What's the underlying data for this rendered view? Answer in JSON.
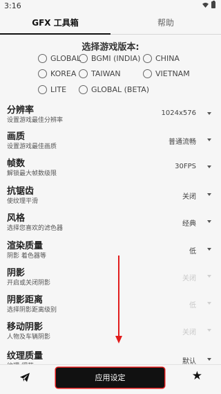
{
  "status": {
    "time": "3:16"
  },
  "tabs": [
    {
      "label": "GFX 工具箱",
      "active": true
    },
    {
      "label": "帮助",
      "active": false
    }
  ],
  "version": {
    "title": "选择游戏版本:",
    "options": [
      "GLOBAL",
      "BGMI (INDIA)",
      "CHINA",
      "KOREA",
      "TAIWAN",
      "VIETNAM",
      "LITE",
      "GLOBAL (BETA)"
    ]
  },
  "settings": [
    {
      "title": "分辨率",
      "desc": "设置游戏最佳分辨率",
      "value": "1024x576",
      "enabled": true
    },
    {
      "title": "画质",
      "desc": "设置游戏最佳画质",
      "value": "普通流畅",
      "enabled": true
    },
    {
      "title": "帧数",
      "desc": "解锁最大帧数级限",
      "value": "30FPS",
      "enabled": true
    },
    {
      "title": "抗锯齿",
      "desc": "使纹理平滑",
      "value": "关闭",
      "enabled": true
    },
    {
      "title": "风格",
      "desc": "选择您喜欢的滤色器",
      "value": "经典",
      "enabled": true
    },
    {
      "title": "渲染质量",
      "desc": "阴影 着色器等",
      "value": "低",
      "enabled": true
    },
    {
      "title": "阴影",
      "desc": "开启或关闭阴影",
      "value": "关闭",
      "enabled": false
    },
    {
      "title": "阴影距离",
      "desc": "选择阴影距离级别",
      "value": "低",
      "enabled": false
    },
    {
      "title": "移动阴影",
      "desc": "人物及车辆阴影",
      "value": "关闭",
      "enabled": false
    },
    {
      "title": "纹理质量",
      "desc": "纹理 细节",
      "value": "默认",
      "enabled": true
    }
  ],
  "bottom": {
    "apply_label": "应用设定"
  },
  "colors": {
    "accent": "#111111",
    "background": "#f6f6f6",
    "annotation": "#e11b1b"
  }
}
